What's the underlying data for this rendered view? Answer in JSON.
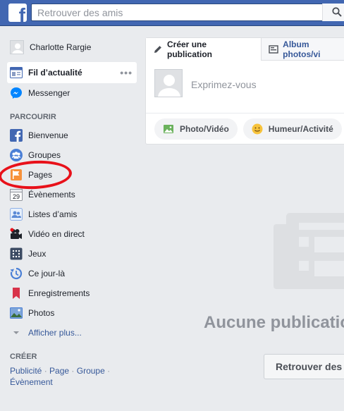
{
  "header": {
    "logo": "f",
    "search_placeholder": "Retrouver des amis",
    "search_icon": "search-icon"
  },
  "sidebar": {
    "profile_name": "Charlotte Rargie",
    "newsfeed_label": "Fil d’actualité",
    "newsfeed_more": "•••",
    "messenger_label": "Messenger",
    "explore_title": "PARCOURIR",
    "explore_items": [
      {
        "label": "Bienvenue",
        "icon": "facebook-icon"
      },
      {
        "label": "Groupes",
        "icon": "groups-icon"
      },
      {
        "label": "Pages",
        "icon": "flag-icon"
      },
      {
        "label": "Évènements",
        "icon": "calendar-icon",
        "icon_text": "29"
      },
      {
        "label": "Listes d’amis",
        "icon": "friend-lists-icon"
      },
      {
        "label": "Vidéo en direct",
        "icon": "live-video-icon"
      },
      {
        "label": "Jeux",
        "icon": "games-icon"
      },
      {
        "label": "Ce jour-là",
        "icon": "on-this-day-icon"
      },
      {
        "label": "Enregistrements",
        "icon": "bookmark-icon"
      },
      {
        "label": "Photos",
        "icon": "photos-icon"
      }
    ],
    "show_more": "Afficher plus...",
    "create_title": "CRÉER",
    "create_links": [
      "Publicité",
      "Page",
      "Groupe",
      "Évènement"
    ],
    "separator": " · "
  },
  "composer": {
    "tab_create": "Créer une publication",
    "tab_album": "Album photos/vi",
    "placeholder": "Exprimez-vous",
    "action_photo": "Photo/Vidéo",
    "action_mood": "Humeur/Activité"
  },
  "feed": {
    "empty_title": "Aucune publication",
    "find_friends_button": "Retrouver des"
  },
  "colors": {
    "brand": "#4267b2",
    "highlight_circle": "#e8111a",
    "link": "#365899"
  }
}
